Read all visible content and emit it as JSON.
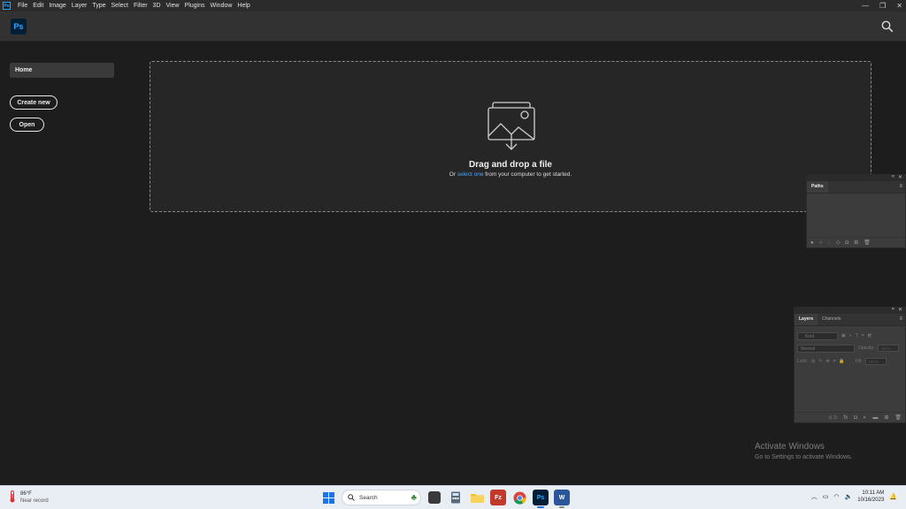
{
  "menubar": {
    "app_icon": "Ps",
    "items": [
      "File",
      "Edit",
      "Image",
      "Layer",
      "Type",
      "Select",
      "Filter",
      "3D",
      "View",
      "Plugins",
      "Window",
      "Help"
    ]
  },
  "header": {
    "logo": "Ps",
    "search_icon": "search-icon"
  },
  "sidebar": {
    "home": "Home",
    "create_new": "Create new",
    "open": "Open"
  },
  "dropzone": {
    "title": "Drag and drop a file",
    "prefix": "Or ",
    "link": "select one",
    "suffix": " from your computer to get started."
  },
  "paths_panel": {
    "tab": "Paths"
  },
  "layers_panel": {
    "tabs": [
      "Layers",
      "Channels"
    ],
    "kind": "Kind",
    "blend_mode": "Normal",
    "opacity_label": "Opacity:",
    "opacity_value": "100%",
    "lock_label": "Lock:",
    "fill_label": "Fill:",
    "fill_value": "100%"
  },
  "watermark": {
    "title": "Activate Windows",
    "subtitle": "Go to Settings to activate Windows."
  },
  "taskbar": {
    "weather_temp": "86°F",
    "weather_desc": "Near record",
    "search_placeholder": "Search",
    "time": "10:11 AM",
    "date": "10/16/2023"
  },
  "colors": {
    "accent": "#31a8ff",
    "link": "#4aa3ff",
    "background": "#1d1d1d"
  }
}
